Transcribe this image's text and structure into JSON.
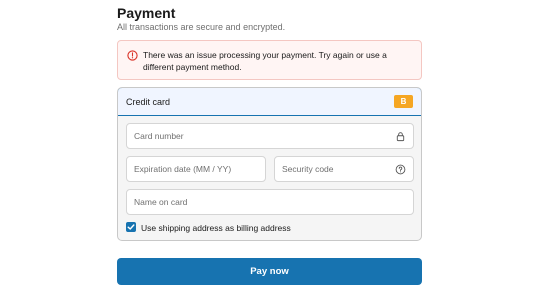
{
  "header": {
    "title": "Payment",
    "subtitle": "All transactions are secure and encrypted."
  },
  "error": {
    "icon": "alert-circle-icon",
    "message": "There was an issue processing your payment. Try again or use a different payment method."
  },
  "payment_method": {
    "label": "Credit card",
    "brand_badge": "B",
    "brand_color": "#f5a623",
    "selected": true
  },
  "fields": {
    "card_number": {
      "placeholder": "Card number",
      "value": "",
      "icon": "lock-icon"
    },
    "expiration": {
      "placeholder": "Expiration date (MM / YY)",
      "value": ""
    },
    "security_code": {
      "placeholder": "Security code",
      "value": "",
      "icon": "help-circle-icon"
    },
    "name_on_card": {
      "placeholder": "Name on card",
      "value": ""
    }
  },
  "billing": {
    "checkbox_label": "Use shipping address as billing address",
    "checked": true
  },
  "pay_button": {
    "label": "Pay now"
  },
  "colors": {
    "accent": "#1773b0",
    "error_bg": "#fff5f4",
    "error_border": "#f4c7c2",
    "error_icon": "#d93025",
    "header_bg": "#f0f5ff"
  }
}
